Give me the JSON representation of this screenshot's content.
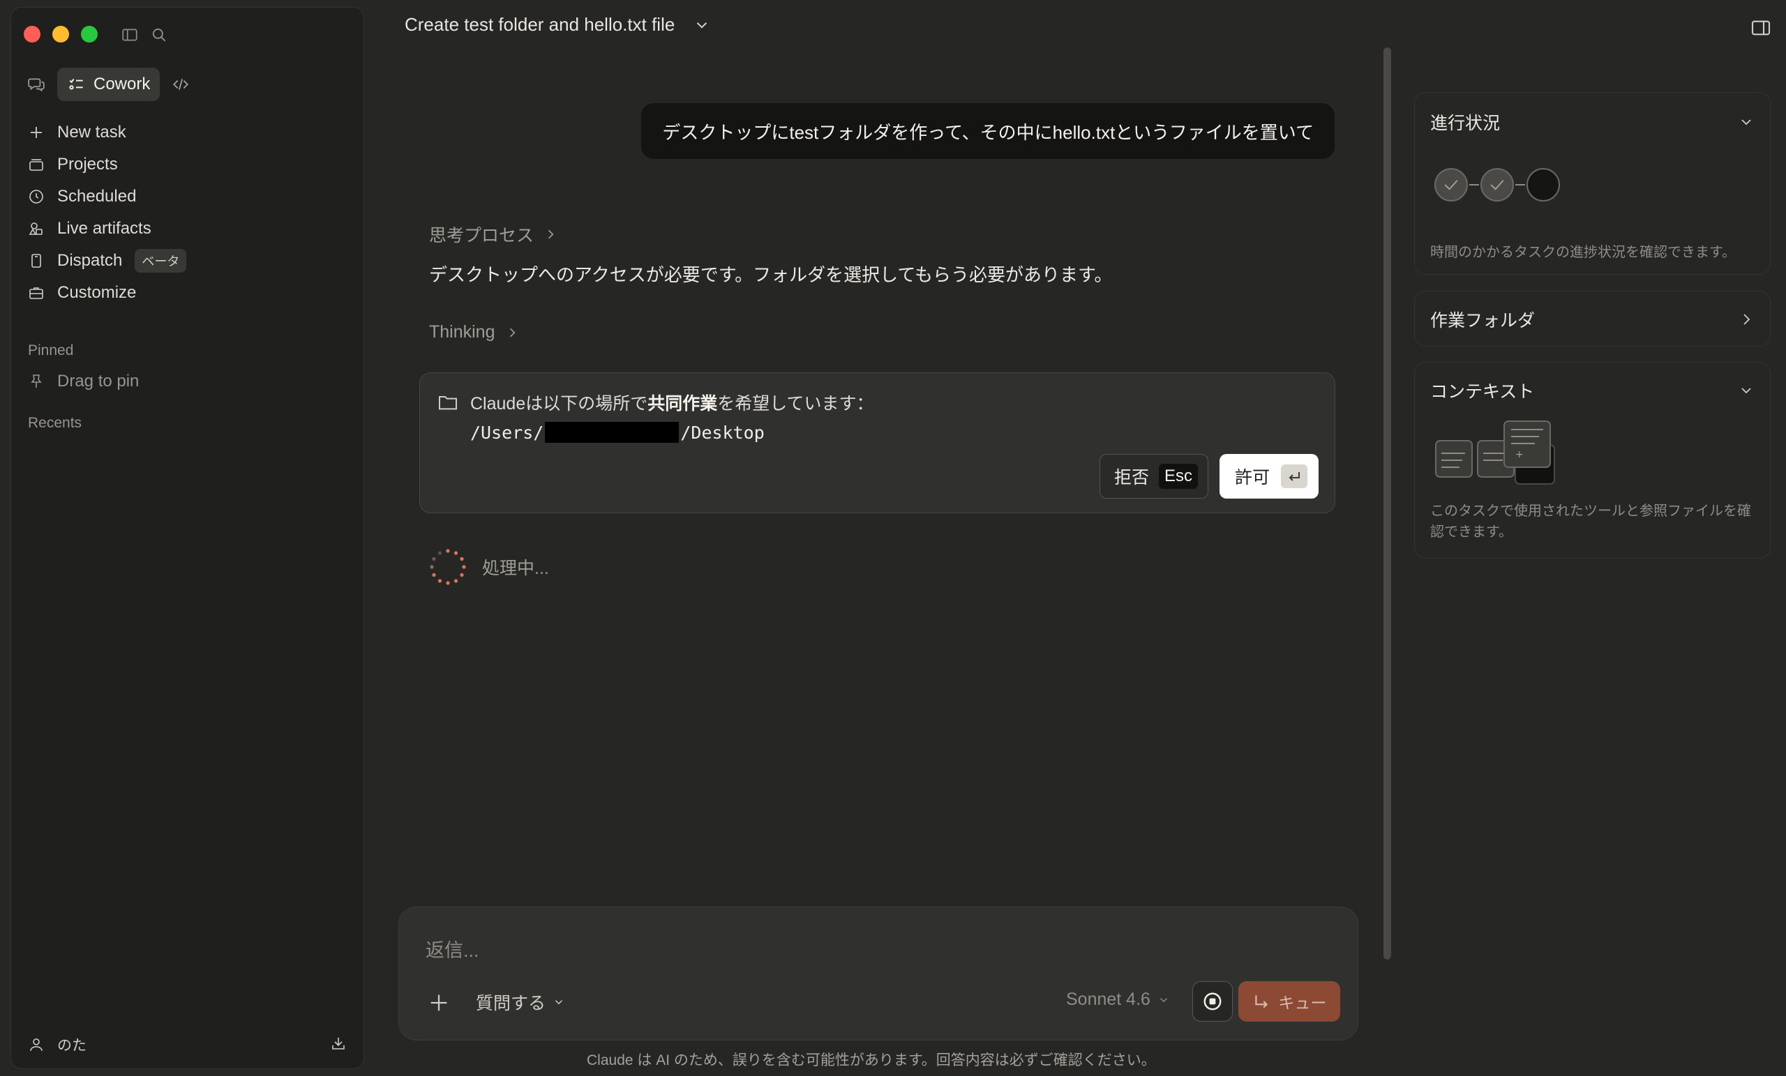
{
  "window": {
    "title": "Create test folder and hello.txt file"
  },
  "sidebar": {
    "mode_label": "Cowork",
    "nav": [
      {
        "label": "New task"
      },
      {
        "label": "Projects"
      },
      {
        "label": "Scheduled"
      },
      {
        "label": "Live artifacts"
      },
      {
        "label": "Dispatch",
        "badge": "ベータ"
      },
      {
        "label": "Customize"
      }
    ],
    "pinned_label": "Pinned",
    "pin_hint": "Drag to pin",
    "recents_label": "Recents",
    "user_name": "のた"
  },
  "chat": {
    "user_message": "デスクトップにtestフォルダを作って、その中にhello.txtというファイルを置いて",
    "thought_process_label": "思考プロセス",
    "assistant_text": "デスクトップへのアクセスが必要です。フォルダを選択してもらう必要があります。",
    "thinking_label": "Thinking",
    "permission": {
      "text_pre": "Claudeは以下の場所で",
      "text_bold": "共同作業",
      "text_post": "を希望しています：",
      "path_prefix": "/Users/",
      "path_suffix": "/Desktop",
      "deny_label": "拒否",
      "deny_key": "Esc",
      "allow_label": "許可"
    },
    "processing_label": "処理中..."
  },
  "composer": {
    "placeholder": "返信...",
    "ask_mode": "質問する",
    "model": "Sonnet 4.6",
    "queue_label": "キュー"
  },
  "disclaimer": "Claude は AI のため、誤りを含む可能性があります。回答内容は必ずご確認ください。",
  "right_panel": {
    "progress": {
      "title": "進行状況",
      "description": "時間のかかるタスクの進捗状況を確認できます。",
      "steps": [
        "done",
        "done",
        "pending"
      ]
    },
    "working_folder": {
      "title": "作業フォルダ"
    },
    "context": {
      "title": "コンテキスト",
      "description": "このタスクで使用されたツールと参照ファイルを確認できます。"
    }
  },
  "colors": {
    "background": "#262624",
    "sidebar": "#1f1f1d",
    "allow_button": "#ffffff",
    "queue_button": "#8c4a34",
    "spinner": "#d97757"
  }
}
